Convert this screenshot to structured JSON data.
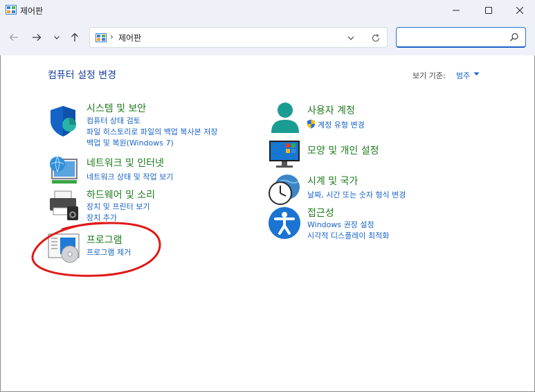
{
  "window": {
    "title": "제어판"
  },
  "address": {
    "chevron": "›",
    "path": "제어판"
  },
  "search": {
    "value": ""
  },
  "content": {
    "heading": "컴퓨터 설정 변경",
    "viewby_label": "보기 기준:",
    "viewby_value": "범주"
  },
  "categories": [
    {
      "title": "시스템 및 보안",
      "links": [
        "컴퓨터 상태 검토",
        "파일 히스토리로 파일의 백업 복사본 저장",
        "백업 및 복원(Windows 7)"
      ]
    },
    {
      "title": "네트워크 및 인터넷",
      "links": [
        "네트워크 상태 및 작업 보기"
      ]
    },
    {
      "title": "하드웨어 및 소리",
      "links": [
        "장치 및 프린터 보기",
        "장치 추가"
      ]
    },
    {
      "title": "프로그램",
      "links": [
        "프로그램 제거"
      ]
    },
    {
      "title": "사용자 계정",
      "links": [
        "계정 유형 변경"
      ]
    },
    {
      "title": "모양 및 개인 설정",
      "links": []
    },
    {
      "title": "시계 및 국가",
      "links": [
        "날짜, 시간 또는 숫자 형식 변경"
      ]
    },
    {
      "title": "접근성",
      "links": [
        "Windows 권장 설정",
        "시각적 디스플레이 최적화"
      ]
    }
  ],
  "icons": {
    "app": "control-panel-icon",
    "minimize": "minimize-icon",
    "maximize": "maximize-icon",
    "close": "close-icon",
    "back": "arrow-left-icon",
    "forward": "arrow-right-icon",
    "recent": "chevron-down-icon",
    "up": "arrow-up-icon",
    "refresh": "refresh-icon",
    "search": "search-icon",
    "uac_shield": "uac-shield-icon"
  },
  "colors": {
    "link": "#1a63c7",
    "category_title": "#1d7a1d",
    "heading": "#1a3e9b",
    "annotation": "#e01818"
  }
}
